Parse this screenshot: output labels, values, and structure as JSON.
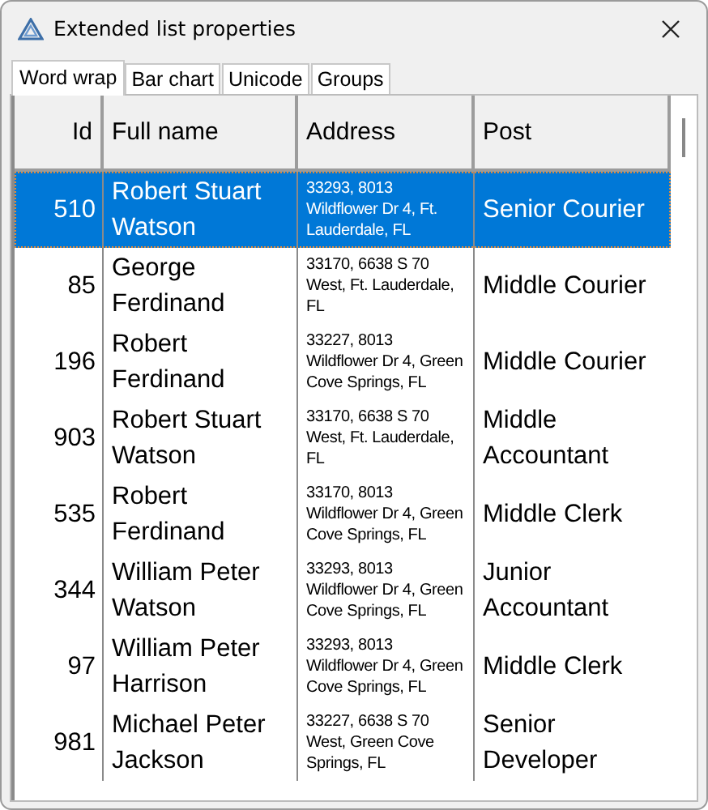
{
  "window": {
    "title": "Extended list properties"
  },
  "tabs": [
    {
      "label": "Word wrap",
      "selected": true
    },
    {
      "label": "Bar chart",
      "selected": false
    },
    {
      "label": "Unicode",
      "selected": false
    },
    {
      "label": "Groups",
      "selected": false
    }
  ],
  "table": {
    "columns": [
      "Id",
      "Full name",
      "Address",
      "Post"
    ],
    "rows": [
      {
        "id": "510",
        "name": "Robert Stuart Watson",
        "address": "33293, 8013 Wildflower Dr 4, Ft. Lauderdale, FL",
        "post": "Senior Courier",
        "selected": true
      },
      {
        "id": "85",
        "name": "George Ferdinand",
        "address": "33170, 6638 S 70 West, Ft. Lauderdale, FL",
        "post": "Middle Courier",
        "selected": false
      },
      {
        "id": "196",
        "name": "Robert Ferdinand",
        "address": "33227, 8013 Wildflower Dr 4, Green Cove Springs, FL",
        "post": "Middle Courier",
        "selected": false
      },
      {
        "id": "903",
        "name": "Robert Stuart Watson",
        "address": "33170, 6638 S 70 West, Ft. Lauderdale, FL",
        "post": "Middle Accountant",
        "selected": false
      },
      {
        "id": "535",
        "name": "Robert Ferdinand",
        "address": "33170, 8013 Wildflower Dr 4, Green Cove Springs, FL",
        "post": "Middle Clerk",
        "selected": false
      },
      {
        "id": "344",
        "name": "William Peter Watson",
        "address": "33293, 8013 Wildflower Dr 4, Green Cove Springs, FL",
        "post": "Junior Accountant",
        "selected": false
      },
      {
        "id": "97",
        "name": "William Peter Harrison",
        "address": "33293, 8013 Wildflower Dr 4, Green Cove Springs, FL",
        "post": "Middle Clerk",
        "selected": false
      },
      {
        "id": "981",
        "name": "Michael Peter Jackson",
        "address": "33227, 6638 S 70 West, Green Cove Springs, FL",
        "post": "Senior Developer",
        "selected": false
      }
    ]
  }
}
